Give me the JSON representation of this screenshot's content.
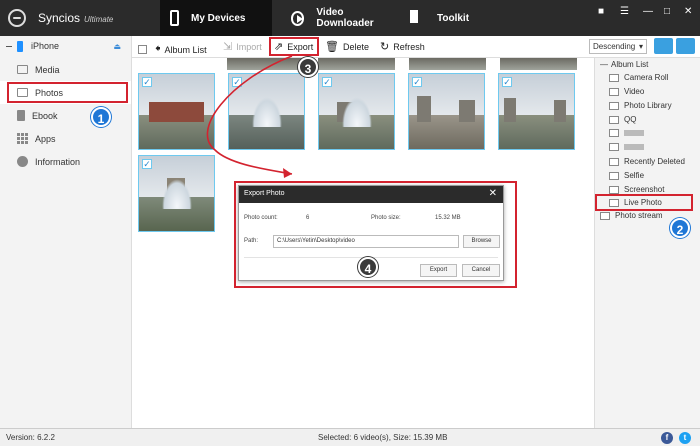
{
  "app": {
    "name": "Syncios",
    "edition": "Ultimate"
  },
  "nav": {
    "my_devices": "My Devices",
    "video_downloader": "Video Downloader",
    "toolkit": "Toolkit"
  },
  "device": {
    "name": "iPhone"
  },
  "sidebar": {
    "items": [
      {
        "label": "Media"
      },
      {
        "label": "Photos"
      },
      {
        "label": "Ebook"
      },
      {
        "label": "Apps"
      },
      {
        "label": "Information"
      }
    ]
  },
  "toolbar": {
    "album_list": "Album List",
    "import": "Import",
    "export": "Export",
    "delete": "Delete",
    "refresh": "Refresh",
    "sort": "Descending"
  },
  "albums": {
    "header": "Album List",
    "items": [
      "Camera Roll",
      "Video",
      "Photo Library",
      "QQ",
      "",
      "",
      "Recently Deleted",
      "Selfie",
      "Screenshot",
      "Live Photo"
    ],
    "footer": "Photo stream"
  },
  "dialog": {
    "title": "Export Photo",
    "count_label": "Photo count:",
    "count_value": "6",
    "size_label": "Photo size:",
    "size_value": "15.32 MB",
    "path_label": "Path:",
    "path_value": "C:\\Users\\Yetin\\Desktop\\video",
    "browse": "Browse",
    "export": "Export",
    "cancel": "Cancel"
  },
  "status": {
    "version": "Version: 6.2.2",
    "selection": "Selected: 6 video(s), Size: 15.39 MB"
  },
  "badges": [
    "1",
    "2",
    "3",
    "4"
  ],
  "colors": {
    "topbar": "#2b2b2b",
    "accent": "#1f77d6",
    "highlight": "#d3232f",
    "selection_border": "#6ec9ef"
  }
}
